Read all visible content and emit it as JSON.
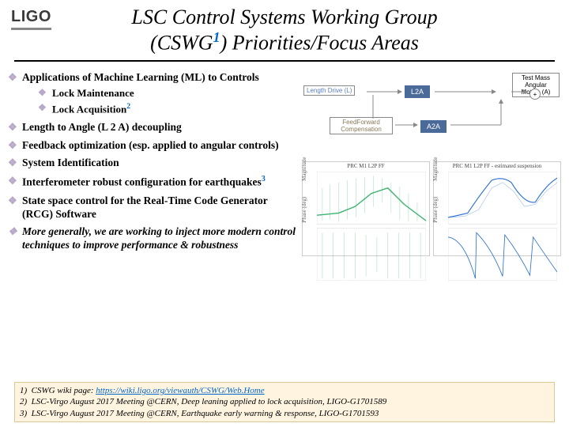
{
  "logo": "LIGO",
  "title_line1": "LSC Control Systems Working Group",
  "title_line2_before": "(CSWG",
  "title_line2_sup": "1",
  "title_line2_after": ") Priorities/Focus Areas",
  "bullets": [
    {
      "text": "Applications of Machine Learning (ML) to Controls",
      "sub": [
        {
          "text": "Lock Maintenance"
        },
        {
          "text": "Lock Acquisition",
          "ref": "2"
        }
      ]
    },
    {
      "text": "Length to Angle (L 2 A) decoupling"
    },
    {
      "text": "Feedback optimization (esp. applied to angular controls)"
    },
    {
      "text": "System Identification"
    },
    {
      "text": "Interferometer robust configuration for earthquakes",
      "ref": "3"
    },
    {
      "text": "State space control for the Real-Time Code Generator (RCG) Software"
    },
    {
      "text": "More generally, we are working to inject more modern control techniques to improve performance & robustness",
      "italic": true
    }
  ],
  "diagram": {
    "length_drive": "Length Drive (L)",
    "test_mass": "Test Mass Angular Motion (A)",
    "l2a": "L2A",
    "plus": "+",
    "ff": "FeedForward Compensation",
    "a2a": "A2A"
  },
  "plots": {
    "left_title": "PRC M1 L2P FF",
    "right_title": "PRC M1 L2P FF - estimated suspension",
    "ylabel_top": "Magnitude",
    "ylabel_bot": "Phase (deg)"
  },
  "footer": [
    {
      "n": "1)",
      "text": "CSWG wiki page: ",
      "link": "https://wiki.ligo.org/viewauth/CSWG/Web.Home"
    },
    {
      "n": "2)",
      "text": "LSC-Virgo August 2017 Meeting @CERN, Deep leaning applied to lock acquisition, LIGO-G1701589"
    },
    {
      "n": "3)",
      "text": "LSC-Virgo August 2017 Meeting @CERN, Earthquake early warning & response, LIGO-G1701593"
    }
  ]
}
